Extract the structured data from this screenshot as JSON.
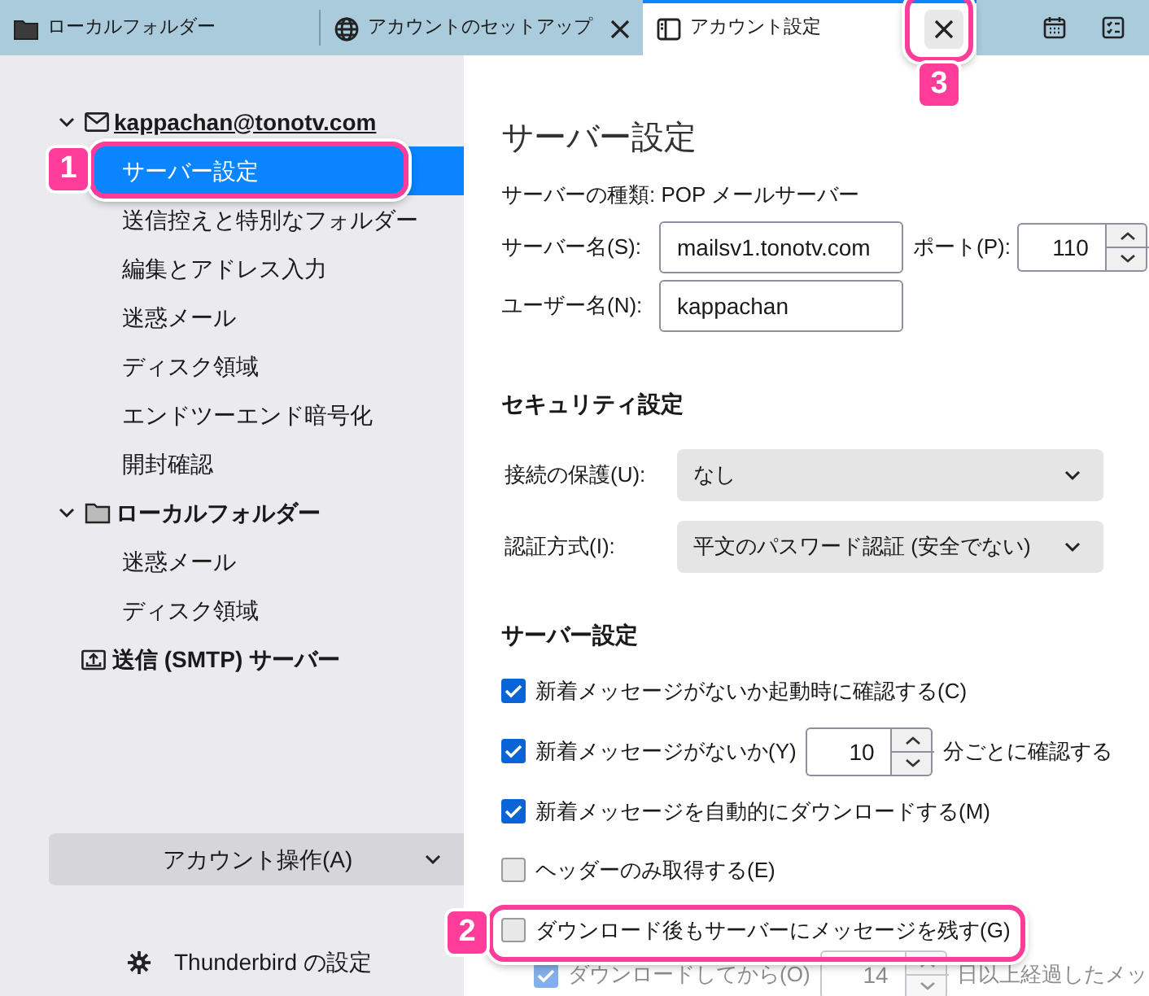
{
  "tabs": [
    {
      "label": "ローカルフォルダー",
      "kind": "folder",
      "closable": false,
      "selected": false
    },
    {
      "label": "アカウントのセットアップ",
      "kind": "globe",
      "closable": true,
      "selected": false
    },
    {
      "label": "アカウント設定",
      "kind": "panel",
      "closable": true,
      "selected": true
    }
  ],
  "sidebar": {
    "accounts": [
      {
        "label": "kappachan@tonotv.com",
        "kind": "mail",
        "expanded": true,
        "children": [
          {
            "label": "サーバー設定",
            "selected": true
          },
          {
            "label": "送信控えと特別なフォルダー",
            "selected": false
          },
          {
            "label": "編集とアドレス入力",
            "selected": false
          },
          {
            "label": "迷惑メール",
            "selected": false
          },
          {
            "label": "ディスク領域",
            "selected": false
          },
          {
            "label": "エンドツーエンド暗号化",
            "selected": false
          },
          {
            "label": "開封確認",
            "selected": false
          }
        ]
      },
      {
        "label": "ローカルフォルダー",
        "kind": "folder",
        "expanded": true,
        "children": [
          {
            "label": "迷惑メール",
            "selected": false
          },
          {
            "label": "ディスク領域",
            "selected": false
          }
        ]
      }
    ],
    "smtp_server": {
      "label": "送信 (SMTP) サーバー"
    },
    "account_actions": {
      "label": "アカウント操作(A)"
    },
    "settings_link": {
      "label": "Thunderbird の設定"
    }
  },
  "content": {
    "title": "サーバー設定",
    "server_type": "サーバーの種類: POP メールサーバー",
    "server_name": {
      "label": "サーバー名(S):",
      "value": "mailsv1.tonotv.com"
    },
    "port": {
      "label": "ポート(P):",
      "value": "110"
    },
    "user_name": {
      "label": "ユーザー名(N):",
      "value": "kappachan"
    },
    "security": {
      "heading": "セキュリティ設定",
      "selects": [
        {
          "label": "接続の保護(U):",
          "value": "なし"
        },
        {
          "label": "認証方式(I):",
          "value": "平文のパスワード認証 (安全でない)"
        }
      ]
    },
    "server_settings": {
      "heading": "サーバー設定",
      "options": [
        {
          "kind": "checkbox",
          "label": "新着メッセージがないか起動時に確認する(C)",
          "checked": true,
          "disabled": false
        },
        {
          "kind": "spinner",
          "label": "新着メッセージがないか(Y)",
          "value": "10",
          "suffix": "分ごとに確認する",
          "checked": true,
          "disabled": false
        },
        {
          "kind": "checkbox",
          "label": "新着メッセージを自動的にダウンロードする(M)",
          "checked": true,
          "disabled": false
        },
        {
          "kind": "checkbox",
          "label": "ヘッダーのみ取得する(E)",
          "checked": false,
          "disabled": false
        },
        {
          "kind": "checkbox",
          "label": "ダウンロード後もサーバーにメッセージを残す(G)",
          "checked": false,
          "disabled": false
        },
        {
          "kind": "spinner",
          "label": "ダウンロードしてから(O)",
          "value": "14",
          "suffix": "日以上経過したメッ",
          "checked": true,
          "disabled": true
        }
      ]
    }
  },
  "callouts": [
    {
      "label": "1"
    },
    {
      "label": "2"
    },
    {
      "label": "3"
    }
  ]
}
